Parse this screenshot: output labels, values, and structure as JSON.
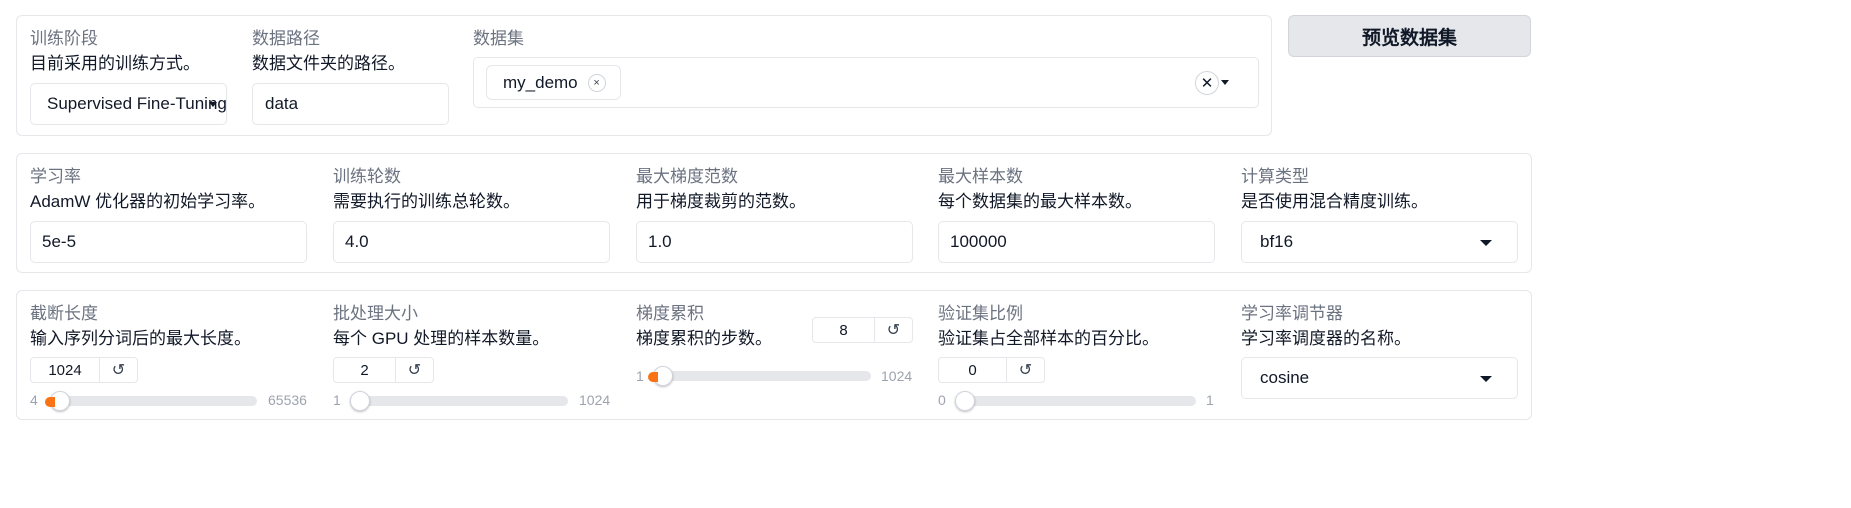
{
  "colors": {
    "accent": "#f97316",
    "border": "#e5e7eb",
    "button_bg": "#e5e7eb"
  },
  "dataset_row": {
    "stage": {
      "label": "训练阶段",
      "desc": "目前采用的训练方式。",
      "value": "Supervised Fine-Tuning",
      "icon": "caret-down-icon"
    },
    "path": {
      "label": "数据路径",
      "desc": "数据文件夹的路径。",
      "value": "data"
    },
    "dataset": {
      "label": "数据集",
      "chips": [
        "my_demo"
      ],
      "chip_remove": "×",
      "clear_all": "✕",
      "icon": "caret-down-icon"
    },
    "preview_button": "预览数据集"
  },
  "hparams_row": {
    "lr": {
      "label": "学习率",
      "desc": "AdamW 优化器的初始学习率。",
      "value": "5e-5"
    },
    "epochs": {
      "label": "训练轮数",
      "desc": "需要执行的训练总轮数。",
      "value": "4.0"
    },
    "max_grad_norm": {
      "label": "最大梯度范数",
      "desc": "用于梯度裁剪的范数。",
      "value": "1.0"
    },
    "max_samples": {
      "label": "最大样本数",
      "desc": "每个数据集的最大样本数。",
      "value": "100000"
    },
    "compute_type": {
      "label": "计算类型",
      "desc": "是否使用混合精度训练。",
      "value": "bf16",
      "icon": "caret-down-icon"
    }
  },
  "sliders_row": {
    "cutoff_len": {
      "label": "截断长度",
      "desc": "输入序列分词后的最大长度。",
      "value": "1024",
      "min": "4",
      "max": "65536",
      "level": 0.0
    },
    "batch_size": {
      "label": "批处理大小",
      "desc": "每个 GPU 处理的样本数量。",
      "value": "2",
      "min": "1",
      "max": "1024",
      "level": 0.0
    },
    "grad_accum": {
      "label": "梯度累积",
      "desc": "梯度累积的步数。",
      "value": "8",
      "min": "1",
      "max": "1024",
      "level": 0.0
    },
    "val_size": {
      "label": "验证集比例",
      "desc": "验证集占全部样本的百分比。",
      "value": "0",
      "min": "0",
      "max": "1",
      "level": 0.0
    },
    "scheduler": {
      "label": "学习率调节器",
      "desc": "学习率调度器的名称。",
      "value": "cosine",
      "icon": "caret-down-icon"
    }
  },
  "reset_glyph": "↺"
}
